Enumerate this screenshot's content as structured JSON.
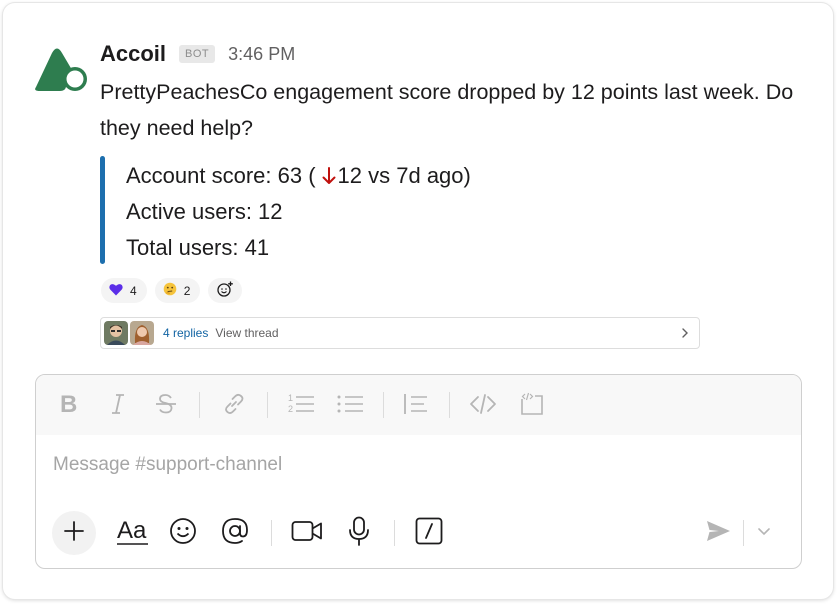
{
  "message": {
    "sender": "Accoil",
    "badge": "BOT",
    "time": "3:46 PM",
    "text": "PrettyPeachesCo engagement score dropped by 12 points last week. Do they need help?",
    "attachment": {
      "score_prefix": "Account score: 63 (",
      "score_suffix": "12 vs 7d ago)",
      "active_users": "Active users: 12",
      "total_users": "Total users: 41",
      "accent_color": "#1d6fae"
    },
    "reactions": [
      {
        "icon": "purple-heart-icon",
        "count": "4"
      },
      {
        "icon": "thinking-face-icon",
        "count": "2"
      }
    ],
    "thread": {
      "replies": "4 replies",
      "view": "View thread"
    }
  },
  "composer": {
    "placeholder": "Message #support-channel",
    "format_tools": [
      "bold",
      "italic",
      "strikethrough",
      "link",
      "ordered-list",
      "bulleted-list",
      "blockquote",
      "code",
      "code-block"
    ],
    "actions": [
      "attach",
      "formatting",
      "emoji",
      "mention",
      "video",
      "audio",
      "slash-command",
      "send"
    ]
  },
  "colors": {
    "brand_green": "#2e7d4f",
    "link_blue": "#1264a3",
    "down_red": "#c0110d"
  }
}
